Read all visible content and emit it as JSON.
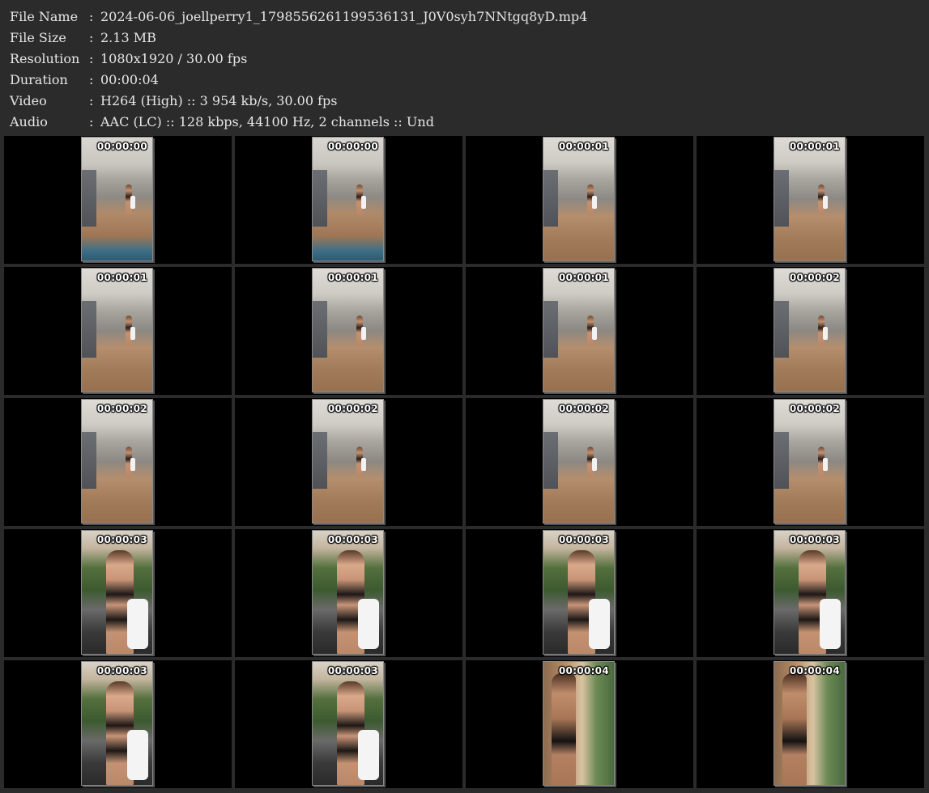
{
  "info": [
    {
      "label": "File Name",
      "value": "2024-06-06_joellperry1_1798556261199536131_J0V0syh7NNtgq8yD.mp4"
    },
    {
      "label": "File Size",
      "value": "2.13 MB"
    },
    {
      "label": "Resolution",
      "value": "1080x1920 / 30.00 fps"
    },
    {
      "label": "Duration",
      "value": "00:00:04"
    },
    {
      "label": "Video",
      "value": "H264 (High) :: 3 954 kb/s, 30.00 fps"
    },
    {
      "label": "Audio",
      "value": "AAC (LC) :: 128 kbps, 44100 Hz, 2 channels :: Und"
    }
  ],
  "separator": ":",
  "thumbnails": [
    {
      "time": "00:00:00",
      "scene": "a"
    },
    {
      "time": "00:00:00",
      "scene": "a"
    },
    {
      "time": "00:00:01",
      "scene": "b"
    },
    {
      "time": "00:00:01",
      "scene": "b"
    },
    {
      "time": "00:00:01",
      "scene": "b"
    },
    {
      "time": "00:00:01",
      "scene": "b"
    },
    {
      "time": "00:00:01",
      "scene": "b"
    },
    {
      "time": "00:00:02",
      "scene": "b"
    },
    {
      "time": "00:00:02",
      "scene": "b"
    },
    {
      "time": "00:00:02",
      "scene": "b"
    },
    {
      "time": "00:00:02",
      "scene": "b"
    },
    {
      "time": "00:00:02",
      "scene": "b"
    },
    {
      "time": "00:00:03",
      "scene": "c"
    },
    {
      "time": "00:00:03",
      "scene": "c"
    },
    {
      "time": "00:00:03",
      "scene": "c"
    },
    {
      "time": "00:00:03",
      "scene": "c"
    },
    {
      "time": "00:00:03",
      "scene": "c"
    },
    {
      "time": "00:00:03",
      "scene": "c"
    },
    {
      "time": "00:00:04",
      "scene": "d"
    },
    {
      "time": "00:00:04",
      "scene": "d"
    }
  ]
}
